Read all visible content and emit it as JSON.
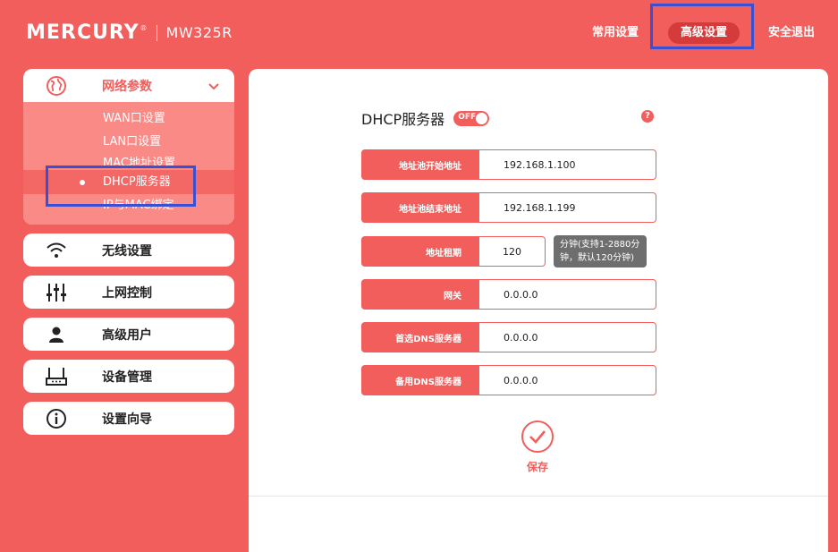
{
  "header": {
    "brand": "MERCURY",
    "model": "MW325R",
    "nav": {
      "common": "常用设置",
      "advanced": "高级设置",
      "exit": "安全退出"
    }
  },
  "sidebar": {
    "network": {
      "label": "网络参数",
      "items": [
        "WAN口设置",
        "LAN口设置",
        "MAC地址设置",
        "DHCP服务器",
        "IP与MAC绑定"
      ],
      "active_index": 3
    },
    "items": [
      {
        "label": "无线设置",
        "icon": "wifi-icon"
      },
      {
        "label": "上网控制",
        "icon": "sliders-icon"
      },
      {
        "label": "高级用户",
        "icon": "user-icon"
      },
      {
        "label": "设备管理",
        "icon": "router-icon"
      },
      {
        "label": "设置向导",
        "icon": "info-icon"
      }
    ]
  },
  "main": {
    "title": "DHCP服务器",
    "toggle_label": "OFF",
    "help": "?",
    "fields": {
      "start": {
        "label": "地址池开始地址",
        "value": "192.168.1.100"
      },
      "end": {
        "label": "地址池结束地址",
        "value": "192.168.1.199"
      },
      "lease": {
        "label": "地址租期",
        "value": "120",
        "note_line1": "分钟(支持1-2880分",
        "note_line2": "钟，默认120分钟)"
      },
      "gateway": {
        "label": "网关",
        "value": "0.0.0.0"
      },
      "dns1": {
        "label": "首选DNS服务器",
        "value": "0.0.0.0"
      },
      "dns2": {
        "label": "备用DNS服务器",
        "value": "0.0.0.0"
      }
    },
    "save_label": "保存"
  },
  "colors": {
    "brand": "#f25e5c",
    "highlight": "#3a4fd1",
    "submenu": "#f98a86",
    "note": "#6e6e6e"
  }
}
